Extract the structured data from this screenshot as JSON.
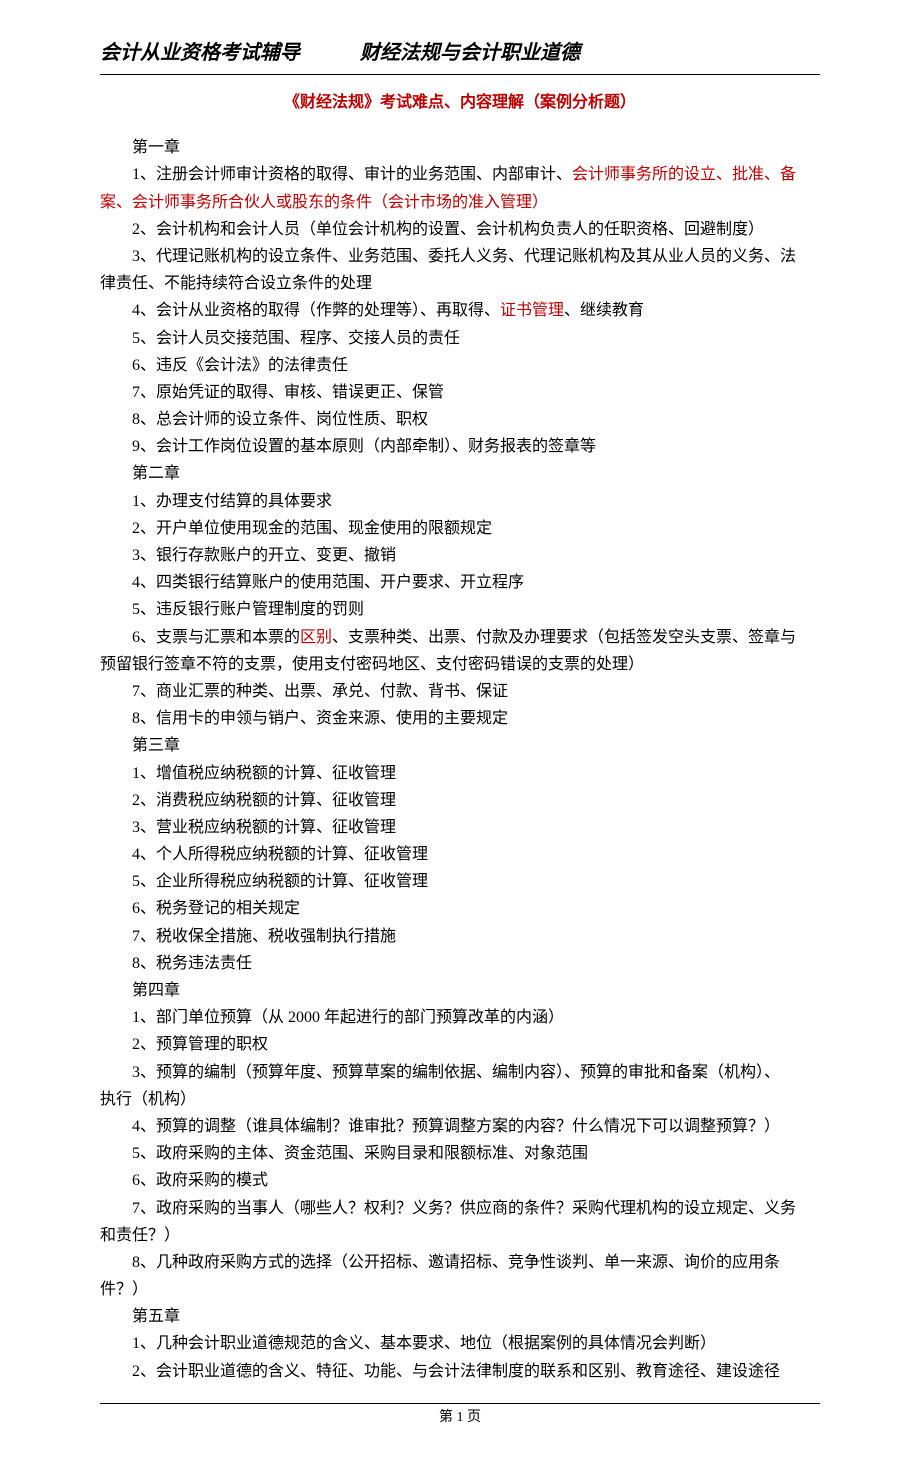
{
  "header": {
    "left": "会计从业资格考试辅导",
    "right": "财经法规与会计职业道德"
  },
  "title": "《财经法规》考试难点、内容理解（案例分析题）",
  "lines": [
    {
      "indent": true,
      "segments": [
        {
          "text": "第一章"
        }
      ]
    },
    {
      "indent": true,
      "segments": [
        {
          "text": "1、注册会计师审计资格的取得、审计的业务范围、内部审计、"
        },
        {
          "text": "会计师事务所的设立、批准、备",
          "red": true
        }
      ]
    },
    {
      "indent": false,
      "segments": [
        {
          "text": "案、会计师事务所合伙人或股东的条件（会计市场的准入管理）",
          "red": true
        }
      ]
    },
    {
      "indent": true,
      "segments": [
        {
          "text": "2、会计机构和会计人员（单位会计机构的设置、会计机构负责人的任职资格、回避制度）"
        }
      ]
    },
    {
      "indent": true,
      "segments": [
        {
          "text": "3、代理记账机构的设立条件、业务范围、委托人义务、代理记账机构及其从业人员的义务、法"
        }
      ]
    },
    {
      "indent": false,
      "segments": [
        {
          "text": "律责任、不能持续符合设立条件的处理"
        }
      ]
    },
    {
      "indent": true,
      "segments": [
        {
          "text": "4、会计从业资格的取得（作弊的处理等）、再取得、"
        },
        {
          "text": "证书管理",
          "red": true
        },
        {
          "text": "、继续教育"
        }
      ]
    },
    {
      "indent": true,
      "segments": [
        {
          "text": "5、会计人员交接范围、程序、交接人员的责任"
        }
      ]
    },
    {
      "indent": true,
      "segments": [
        {
          "text": "6、违反《会计法》的法律责任"
        }
      ]
    },
    {
      "indent": true,
      "segments": [
        {
          "text": "7、原始凭证的取得、审核、错误更正、保管"
        }
      ]
    },
    {
      "indent": true,
      "segments": [
        {
          "text": "8、总会计师的设立条件、岗位性质、职权"
        }
      ]
    },
    {
      "indent": true,
      "segments": [
        {
          "text": "9、会计工作岗位设置的基本原则（内部牵制）、财务报表的签章等"
        }
      ]
    },
    {
      "indent": true,
      "segments": [
        {
          "text": "第二章"
        }
      ]
    },
    {
      "indent": true,
      "segments": [
        {
          "text": "1、办理支付结算的具体要求"
        }
      ]
    },
    {
      "indent": true,
      "segments": [
        {
          "text": "2、开户单位使用现金的范围、现金使用的限额规定"
        }
      ]
    },
    {
      "indent": true,
      "segments": [
        {
          "text": "3、银行存款账户的开立、变更、撤销"
        }
      ]
    },
    {
      "indent": true,
      "segments": [
        {
          "text": "4、四类银行结算账户的使用范围、开户要求、开立程序"
        }
      ]
    },
    {
      "indent": true,
      "segments": [
        {
          "text": "5、违反银行账户管理制度的罚则"
        }
      ]
    },
    {
      "indent": true,
      "segments": [
        {
          "text": "6、支票与汇票和本票的"
        },
        {
          "text": "区别",
          "red": true
        },
        {
          "text": "、支票种类、出票、付款及办理要求（包括签发空头支票、签章与"
        }
      ]
    },
    {
      "indent": false,
      "segments": [
        {
          "text": "预留银行签章不符的支票，使用支付密码地区、支付密码错误的支票的处理）"
        }
      ]
    },
    {
      "indent": true,
      "segments": [
        {
          "text": "7、商业汇票的种类、出票、承兑、付款、背书、保证"
        }
      ]
    },
    {
      "indent": true,
      "segments": [
        {
          "text": "8、信用卡的申领与销户、资金来源、使用的主要规定"
        }
      ]
    },
    {
      "indent": true,
      "segments": [
        {
          "text": "第三章"
        }
      ]
    },
    {
      "indent": true,
      "segments": [
        {
          "text": "1、增值税应纳税额的计算、征收管理"
        }
      ]
    },
    {
      "indent": true,
      "segments": [
        {
          "text": "2、消费税应纳税额的计算、征收管理"
        }
      ]
    },
    {
      "indent": true,
      "segments": [
        {
          "text": "3、营业税应纳税额的计算、征收管理"
        }
      ]
    },
    {
      "indent": true,
      "segments": [
        {
          "text": "4、个人所得税应纳税额的计算、征收管理"
        }
      ]
    },
    {
      "indent": true,
      "segments": [
        {
          "text": "5、企业所得税应纳税额的计算、征收管理"
        }
      ]
    },
    {
      "indent": true,
      "segments": [
        {
          "text": "6、税务登记的相关规定"
        }
      ]
    },
    {
      "indent": true,
      "segments": [
        {
          "text": "7、税收保全措施、税收强制执行措施"
        }
      ]
    },
    {
      "indent": true,
      "segments": [
        {
          "text": "8、税务违法责任"
        }
      ]
    },
    {
      "indent": true,
      "segments": [
        {
          "text": "第四章"
        }
      ]
    },
    {
      "indent": true,
      "segments": [
        {
          "text": "1、部门单位预算（从 2000 年起进行的部门预算改革的内涵）"
        }
      ]
    },
    {
      "indent": true,
      "segments": [
        {
          "text": "2、预算管理的职权"
        }
      ]
    },
    {
      "indent": true,
      "segments": [
        {
          "text": "3、预算的编制（预算年度、预算草案的编制依据、编制内容）、预算的审批和备案（机构）、"
        }
      ]
    },
    {
      "indent": false,
      "segments": [
        {
          "text": "执行（机构）"
        }
      ]
    },
    {
      "indent": true,
      "segments": [
        {
          "text": "4、预算的调整（谁具体编制？谁审批？预算调整方案的内容？什么情况下可以调整预算？）"
        }
      ]
    },
    {
      "indent": true,
      "segments": [
        {
          "text": "5、政府采购的主体、资金范围、采购目录和限额标准、对象范围"
        }
      ]
    },
    {
      "indent": true,
      "segments": [
        {
          "text": "6、政府采购的模式"
        }
      ]
    },
    {
      "indent": true,
      "segments": [
        {
          "text": "7、政府采购的当事人（哪些人？权利？义务？供应商的条件？采购代理机构的设立规定、义务"
        }
      ]
    },
    {
      "indent": false,
      "segments": [
        {
          "text": "和责任？）"
        }
      ]
    },
    {
      "indent": true,
      "segments": [
        {
          "text": "8、几种政府采购方式的选择（公开招标、邀请招标、竞争性谈判、单一来源、询价的应用条"
        }
      ]
    },
    {
      "indent": false,
      "segments": [
        {
          "text": "件？）"
        }
      ]
    },
    {
      "indent": true,
      "segments": [
        {
          "text": "第五章"
        }
      ]
    },
    {
      "indent": true,
      "segments": [
        {
          "text": "1、几种会计职业道德规范的含义、基本要求、地位（根据案例的具体情况会判断）"
        }
      ]
    },
    {
      "indent": true,
      "segments": [
        {
          "text": "2、会计职业道德的含义、特征、功能、与会计法律制度的联系和区别、教育途径、建设途径"
        }
      ]
    }
  ],
  "footer": "第 1 页"
}
